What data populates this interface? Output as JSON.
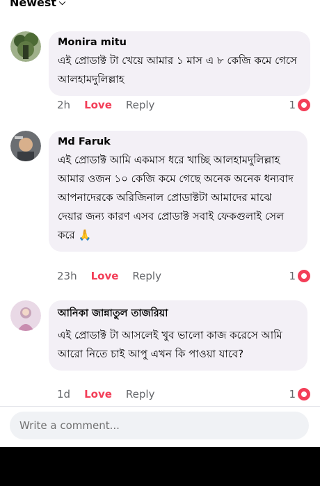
{
  "sort": {
    "label": "Newest"
  },
  "comments": [
    {
      "author": "Monira mitu",
      "text": "এই প্রোডাক্ট টা খেয়ে আমার ১ মাস এ ৮ কেজি কমে গেসে আলহামদুলিল্লাহ",
      "time": "2h",
      "love": "Love",
      "reply": "Reply",
      "reactions": "1",
      "reaction_icon": "love-icon"
    },
    {
      "author": "Md Faruk",
      "text": "এই প্রোডাক্ট আমি একমাস ধরে খাচ্ছি আলহামদুলিল্লাহ আমার ওজন ১০ কেজি কমে গেছে অনেক অনেক ধন্যবাদ আপনাদেরকে অরিজিনাল প্রোডাক্টটা আমাদের মাঝে দেয়ার জন্য কারণ এসব প্রোডাক্ট সবাই ফেকগুলাই সেল করে 🙏",
      "time": "23h",
      "love": "Love",
      "reply": "Reply",
      "reactions": "1",
      "reaction_icon": "love-icon"
    },
    {
      "author": "আনিকা জান্নাতুল তাজরিয়া",
      "text": "এই প্রোডাক্ট টা আসলেই খুব ভালো কাজ করেসে আমি আরো নিতে চাই আপু এখন কি পাওয়া যাবে?",
      "time": "1d",
      "love": "Love",
      "reply": "Reply",
      "reactions": "1",
      "reaction_icon": "love-icon"
    }
  ],
  "composer": {
    "placeholder": "Write a comment..."
  },
  "colors": {
    "love": "#f33e58",
    "bubble": "#f3f0f6",
    "meta": "#65676b"
  }
}
